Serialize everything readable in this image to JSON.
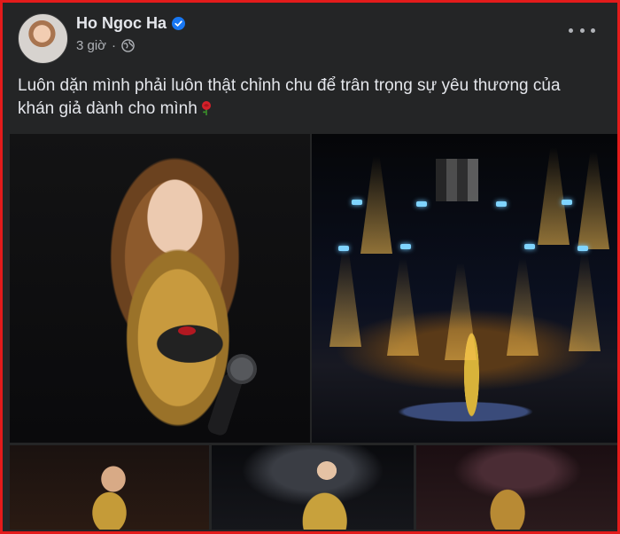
{
  "post": {
    "author": "Ho Ngoc Ha",
    "time": "3 giờ",
    "separator": "·",
    "caption": "Luôn dặn mình phải luôn thật chỉnh chu để trân trọng sự yêu thương của khán giả dành cho mình",
    "emoji": "rose-emoji"
  },
  "icons": {
    "verified": "verified-badge-icon",
    "audience": "globe-icon",
    "more": "more-options-icon"
  },
  "colors": {
    "frame_border": "#e31b1b",
    "card_bg": "#242526",
    "text_primary": "#e4e6eb",
    "text_secondary": "#b0b3b8",
    "verified_blue": "#1877f2"
  },
  "photos": [
    "photo-closeup-microphone",
    "photo-stage-performance",
    "photo-bottom-1",
    "photo-bottom-2",
    "photo-bottom-3"
  ]
}
